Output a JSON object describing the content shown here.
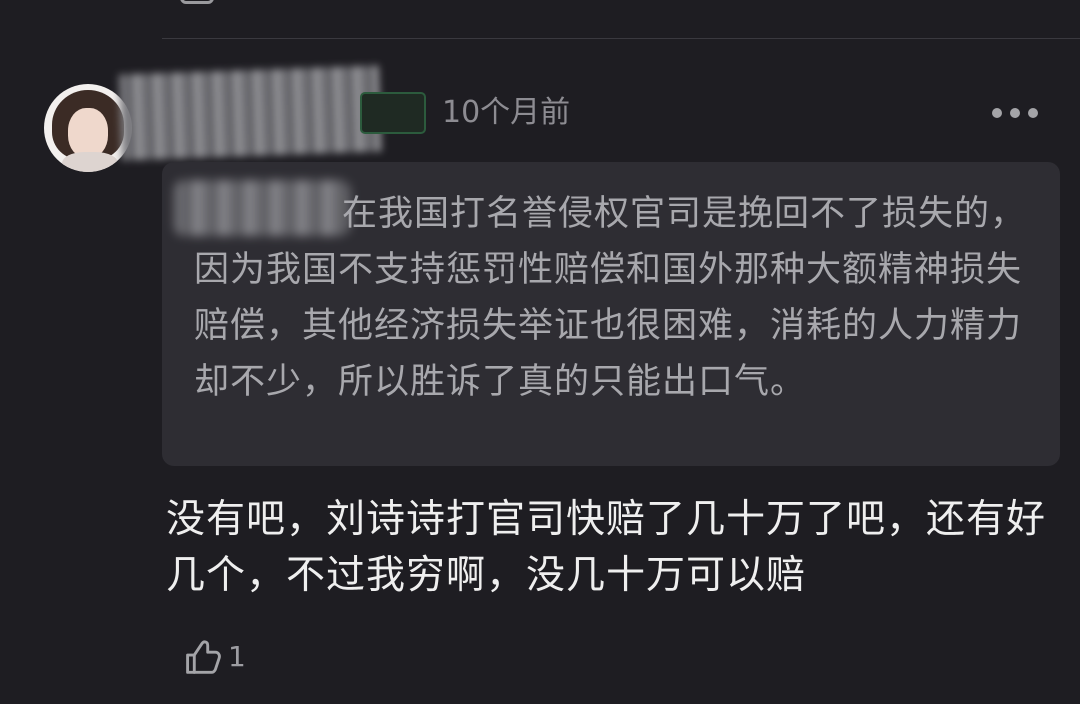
{
  "comment": {
    "timestamp": "10个月前",
    "quote_text": "在我国打名誉侵权官司是挽回不了损失的，因为我国不支持惩罚性赔偿和国外那种大额精神损失赔偿，其他经济损失举证也很困难，消耗的人力精力却不少，所以胜诉了真的只能出口气。",
    "reply_text": "没有吧，刘诗诗打官司快赔了几十万了吧，还有好几个，不过我穷啊，没几十万可以赔",
    "like_count": "1"
  },
  "icons": {
    "top_icon": "box-icon",
    "more_icon": "more-icon",
    "like_icon": "like-icon"
  }
}
